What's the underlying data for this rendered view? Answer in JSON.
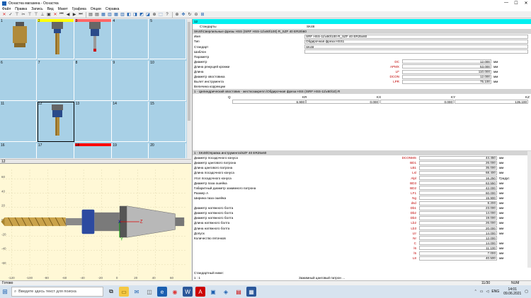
{
  "window": {
    "title": "Оснастка магазина - Оснастка",
    "min": "—",
    "max": "☐",
    "close": "✕"
  },
  "menu": [
    "Файл",
    "Правка",
    "Запись",
    "Вид",
    "Макет",
    "Графика",
    "Опции",
    "Справка"
  ],
  "grid": {
    "slots": [
      "1",
      "2",
      "3",
      "4",
      "5",
      "6",
      "7",
      "8",
      "9",
      "10",
      "11",
      "12",
      "13",
      "14",
      "15",
      "16",
      "17",
      "18",
      "19",
      "20"
    ],
    "strip_colors": {
      "2": "#ffff00",
      "3": "#ff6666",
      "18": "#ff0000"
    }
  },
  "viewport": {
    "header": "12",
    "y_ticks": [
      "60",
      "40",
      "20",
      "0",
      "-20",
      "-40",
      "-60"
    ],
    "x_ticks": [
      "-120",
      "-100",
      "-80",
      "-60",
      "-40",
      "-20",
      "0",
      "20",
      "40",
      "60"
    ]
  },
  "panel": {
    "slot_label": "12",
    "standards_label": "Стандарты",
    "standards_value": "SK48",
    "tool_path": "SK40\\Сверлильные фрезы HSS (ISRF HSS-11\\x60\\100) R_SZF 40 ER25\\60",
    "fields": [
      {
        "label": "Имя",
        "value": "SRF HSS-11\\x60\\100 R_SZF 40 ER25x60"
      },
      {
        "label": "Тип",
        "value": "Обдирочная фреза HSS1"
      },
      {
        "label": "Стандарт",
        "value": "SK48"
      },
      {
        "label": "Шаблон",
        "value": ""
      }
    ],
    "param_header": "Параметр",
    "params": [
      {
        "label": "Диаметр",
        "code": "DC",
        "value": "12.000",
        "unit": "мм"
      },
      {
        "label": "Длина режущей кромки",
        "code": "APMX",
        "value": "53.000",
        "unit": "мм"
      },
      {
        "label": "Длина",
        "code": "LF",
        "value": "110.000",
        "unit": "мм"
      },
      {
        "label": "Диаметр хвостовика",
        "code": "DCON",
        "value": "12.000",
        "unit": "мм"
      },
      {
        "label": "Вылет инструмента",
        "code": "LPR",
        "value": "75.100",
        "unit": "мм"
      }
    ],
    "correction_label": "Величина коррекции",
    "correction_path": "1 - Цилиндрический хвостовик - жесткозакрепл.\\Обдирочная фреза HSS (ISRF HSS-11\\x60\\10) R",
    "corr_headers": [
      "Q",
      "KR",
      "KX",
      "KY",
      "KZ"
    ],
    "corr_values": [
      "6.900",
      "0.000",
      "0.000",
      "135.100"
    ],
    "holder_path": "1 - SK48\\Оправка инструмента\\SZF 40 ER25x60",
    "holder_params": [
      {
        "label": "Диаметр посадочного конуса",
        "code": "DCONMS",
        "value": "44.450",
        "unit": "мм"
      },
      {
        "label": "Диаметр цангового патрона",
        "code": "BD1",
        "value": "26.000",
        "unit": "мм"
      },
      {
        "label": "Длина цангового патрона",
        "code": "LB1",
        "value": "35.000",
        "unit": "мм"
      },
      {
        "label": "Длина посадочного конуса",
        "code": "Lsl",
        "value": "68.400",
        "unit": "мм"
      },
      {
        "label": "Угол посадочного конуса",
        "code": "Alpl",
        "value": "16.250",
        "unit": "Градус"
      },
      {
        "label": "Диаметр паза ошейка",
        "code": "BD3",
        "value": "63.550",
        "unit": "мм"
      },
      {
        "label": "Габаритный диаметр зажимного патрона",
        "code": "BD2",
        "value": "42.000",
        "unit": "мм"
      },
      {
        "label": "Размер А",
        "code": "LF1",
        "value": "60.000",
        "unit": "мм"
      },
      {
        "label": "Ширина паза ошейка",
        "code": "Ng",
        "value": "15.900",
        "unit": "мм"
      },
      {
        "label": "",
        "code": "dsd",
        "value": "8.200",
        "unit": "мм"
      },
      {
        "label": "Диаметр натяжного болта",
        "code": "Db1",
        "value": "23.000",
        "unit": "мм"
      },
      {
        "label": "Диаметр натяжного болта",
        "code": "Db2",
        "value": "14.000",
        "unit": "мм"
      },
      {
        "label": "Диаметр натяжного болта",
        "code": "Db3",
        "value": "19.000",
        "unit": "мм"
      },
      {
        "label": "Длина натяжного болта",
        "code": "Lb2",
        "value": "26.000",
        "unit": "мм"
      },
      {
        "label": "Длина натяжного болта",
        "code": "Lb3",
        "value": "20.000",
        "unit": "мм"
      },
      {
        "label": "Допуск",
        "code": "Ltr",
        "value": "14.000",
        "unit": "мм"
      },
      {
        "label": "Количество пятачков",
        "code": "Nr",
        "value": "12.000",
        "unit": ""
      },
      {
        "label": "",
        "code": "C",
        "value": "14.000",
        "unit": "мм"
      },
      {
        "label": "",
        "code": "l6",
        "value": "11.100",
        "unit": "мм"
      },
      {
        "label": "",
        "code": "l5",
        "value": "7.000",
        "unit": "мм"
      },
      {
        "label": "",
        "code": "L8",
        "value": "40.500",
        "unit": "мм"
      }
    ],
    "footer1": "Стандартный ниже:",
    "footer2": "Зажимный цанговый патрон ...",
    "footer_left": "1 : 1"
  },
  "status": {
    "left": "Готово",
    "page": "11/30",
    "num": "NUM"
  },
  "taskbar": {
    "search_placeholder": "Введите здесь текст для поиска",
    "lang": "ENG",
    "time": "14:01",
    "date": "09.06.2021"
  }
}
